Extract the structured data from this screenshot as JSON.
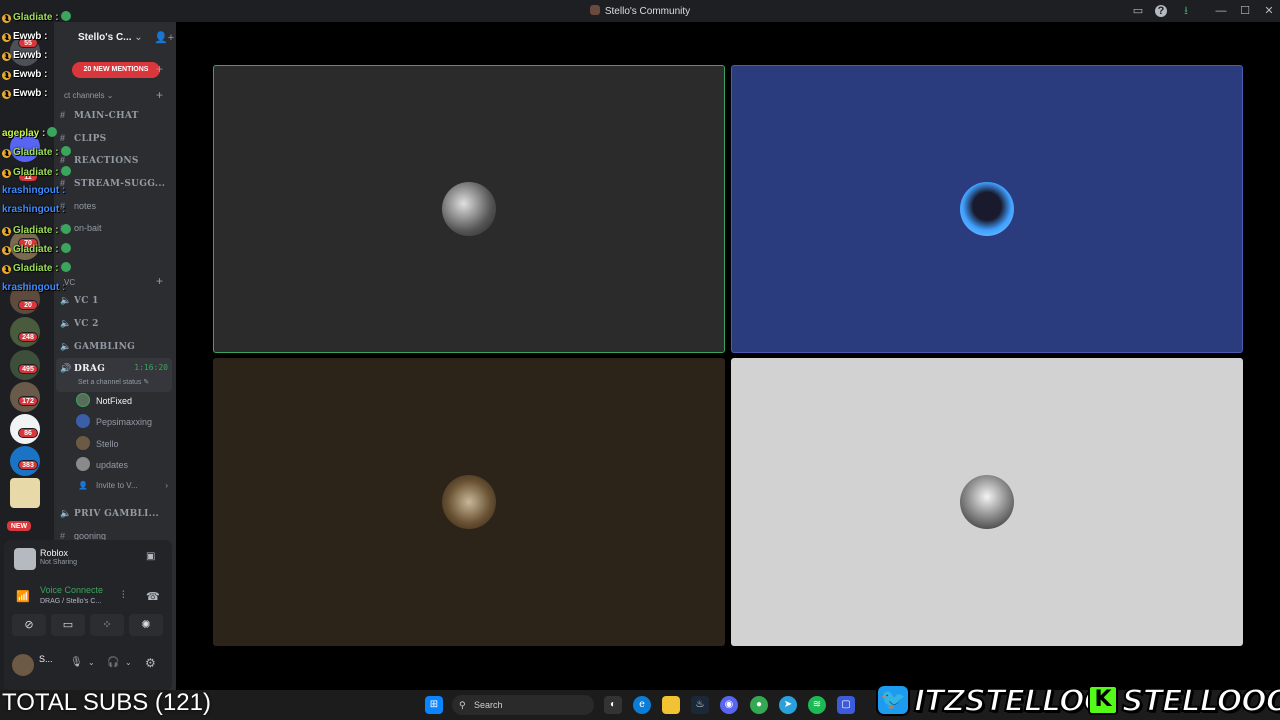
{
  "window": {
    "title": "Stello's Community"
  },
  "server": {
    "name": "Stello's C...",
    "mentions_label": "20 NEW MENTIONS"
  },
  "rail_badges": [
    "55",
    "11",
    "70",
    "20",
    "248",
    "495",
    "172",
    "86",
    "383",
    "NEW"
  ],
  "categories": {
    "text": "ct channels",
    "voice": "VC"
  },
  "text_channels": [
    "MAIN-CHAT",
    "CLIPS",
    "REACTIONS",
    "STREAM-SUGG...",
    "notes",
    "on-bait"
  ],
  "voice_channels": [
    "VC 1",
    "VC 2",
    "GAMBLING"
  ],
  "active_voice": {
    "name": "DRAG",
    "timer": "1:16:20",
    "status_hint": "Set a channel status"
  },
  "voice_members": [
    "NotFixed",
    "Pepsimaxxing",
    "Stello",
    "updates"
  ],
  "invite_label": "Invite to V...",
  "more_channels": [
    "PRIV GAMBLI...",
    "gooning"
  ],
  "activity": {
    "app": "Roblox",
    "state": "Not Sharing"
  },
  "voice_status": {
    "label": "Voice Connecte",
    "location": "DRAG / Stello's C..."
  },
  "user": {
    "name": "S..."
  },
  "chat_overlay": [
    {
      "name": "Gladiate :"
    },
    {
      "name": "Ewwb :"
    },
    {
      "name": "Ewwb :"
    },
    {
      "name": "Ewwb :"
    },
    {
      "name": "Ewwb :"
    },
    {
      "name": "ageplay :"
    },
    {
      "name": "Gladiate :"
    },
    {
      "name": "Gladiate :"
    },
    {
      "name": "krashingout :"
    },
    {
      "name": "krashingout :"
    },
    {
      "name": "Gladiate :"
    },
    {
      "name": "Gladiate :"
    },
    {
      "name": "Gladiate :"
    },
    {
      "name": "krashingout :"
    }
  ],
  "taskbar": {
    "search": "Search"
  },
  "overlay": {
    "subs": "TOTAL SUBS (121)",
    "twitter": "ITZSTELLOO",
    "kick": "STELLOOO"
  },
  "colors": {
    "speaking": "#3ba55d",
    "mention": "#da373c",
    "tile_blue": "#2b3c7e",
    "tile_brown": "#2d2419",
    "tile_gray": "#d2d2d2",
    "tile_dark": "#2b2b2b"
  }
}
